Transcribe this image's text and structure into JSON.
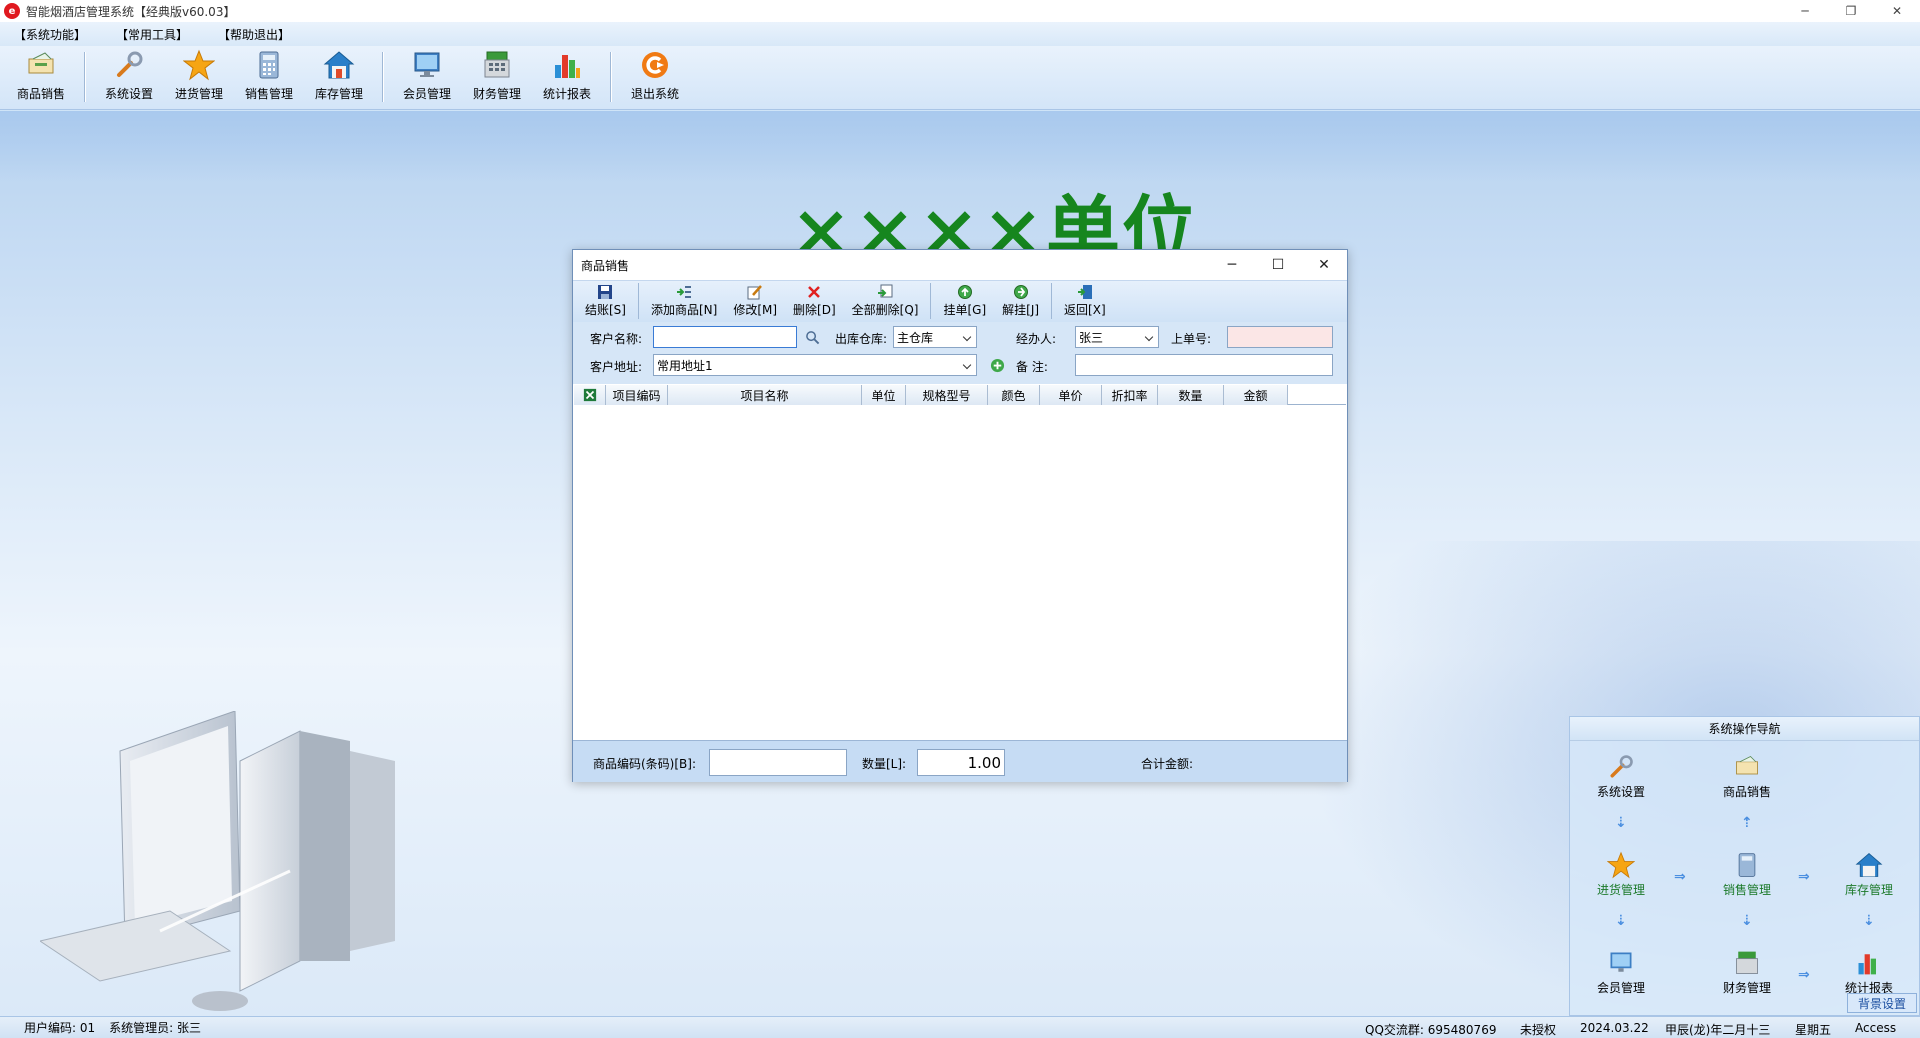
{
  "window": {
    "title": "智能烟酒店管理系统【经典版v60.03】",
    "logo_text": "e"
  },
  "menu": [
    "【系统功能】",
    "【常用工具】",
    "【帮助退出】"
  ],
  "toolbar": [
    {
      "label": "商品销售",
      "icon": "goods-sale-icon"
    },
    {
      "label": "系统设置",
      "icon": "wrench-icon"
    },
    {
      "label": "进货管理",
      "icon": "star-icon"
    },
    {
      "label": "销售管理",
      "icon": "calculator-icon"
    },
    {
      "label": "库存管理",
      "icon": "house-icon"
    },
    {
      "label": "会员管理",
      "icon": "monitor-icon"
    },
    {
      "label": "财务管理",
      "icon": "cash-register-icon"
    },
    {
      "label": "统计报表",
      "icon": "bar-chart-icon"
    },
    {
      "label": "退出系统",
      "icon": "exit-icon"
    }
  ],
  "banner": {
    "unit_name": "××××单位"
  },
  "dialog": {
    "title": "商品销售",
    "tools": [
      {
        "label": "结账[S]",
        "icon": "save-icon"
      },
      {
        "label": "添加商品[N]",
        "icon": "add-list-icon"
      },
      {
        "label": "修改[M]",
        "icon": "edit-icon"
      },
      {
        "label": "删除[D]",
        "icon": "delete-icon"
      },
      {
        "label": "全部删除[Q]",
        "icon": "delete-all-icon"
      },
      {
        "label": "挂单[G]",
        "icon": "hold-order-icon"
      },
      {
        "label": "解挂[J]",
        "icon": "release-order-icon"
      },
      {
        "label": "返回[X]",
        "icon": "return-door-icon"
      }
    ],
    "form": {
      "customer_name_label": "客户名称:",
      "customer_name_value": "",
      "warehouse_label": "出库仓库:",
      "warehouse_value": "主仓库",
      "handler_label": "经办人:",
      "handler_value": "张三",
      "prev_order_label": "上单号:",
      "prev_order_value": "",
      "address_label": "客户地址:",
      "address_value": "常用地址1",
      "remark_label": "备  注:",
      "remark_value": ""
    },
    "columns": [
      "项目编码",
      "项目名称",
      "单位",
      "规格型号",
      "颜色",
      "单价",
      "折扣率",
      "数量",
      "金额"
    ],
    "footer": {
      "barcode_label": "商品编码(条码)[B]:",
      "barcode_value": "",
      "qty_label": "数量[L]:",
      "qty_value": "1.00",
      "total_label": "合计金额:"
    }
  },
  "nav": {
    "title": "系统操作导航",
    "items": {
      "settings": "系统设置",
      "sale": "商品销售",
      "purchase": "进货管理",
      "sales_mgmt": "销售管理",
      "stock": "库存管理",
      "member": "会员管理",
      "finance": "财务管理",
      "report": "统计报表"
    },
    "bg_button": "背景设置"
  },
  "status": {
    "user_code": "用户编码:  01",
    "admin": "系统管理员:  张三",
    "qq": "QQ交流群:  695480769",
    "license": "未授权",
    "date": "2024.03.22",
    "lunar": "甲辰(龙)年二月十三",
    "weekday": "星期五",
    "db": "Access"
  }
}
